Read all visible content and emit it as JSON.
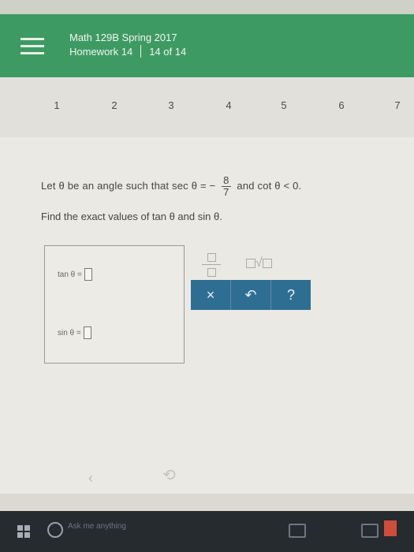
{
  "header": {
    "course": "Math 129B Spring 2017",
    "homework": "Homework 14",
    "progress": "14 of 14"
  },
  "question_nav": [
    "1",
    "2",
    "3",
    "4",
    "5",
    "6",
    "7"
  ],
  "problem": {
    "intro": "Let θ be an angle such that sec θ = −",
    "frac_num": "8",
    "frac_den": "7",
    "tail": "and cot θ < 0.",
    "find": "Find the exact values of tan θ and sin θ."
  },
  "answers": {
    "tan_label": "tan θ =",
    "sin_label": "sin θ ="
  },
  "toolbar": {
    "clear": "×",
    "undo": "↶",
    "help": "?"
  },
  "taskbar": {
    "search_placeholder": "Ask me anything"
  },
  "colors": {
    "header_bg": "#3e9a63",
    "button_bar": "#2f6e93"
  }
}
